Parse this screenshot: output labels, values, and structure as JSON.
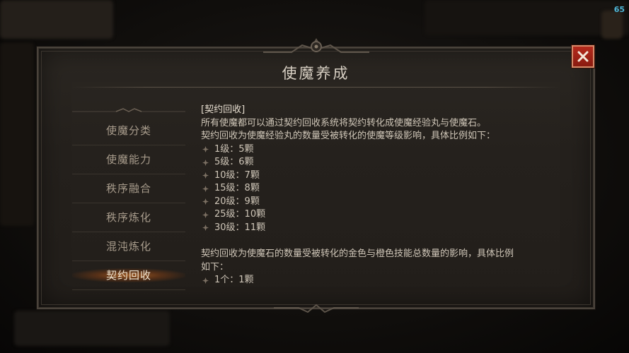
{
  "fps": "65",
  "dialog": {
    "title": "使魔养成",
    "close_icon": "close-x-icon"
  },
  "sidebar": {
    "items": [
      {
        "label": "使魔分类",
        "active": false
      },
      {
        "label": "使魔能力",
        "active": false
      },
      {
        "label": "秩序融合",
        "active": false
      },
      {
        "label": "秩序炼化",
        "active": false
      },
      {
        "label": "混沌炼化",
        "active": false
      },
      {
        "label": "契约回收",
        "active": true
      }
    ]
  },
  "content": {
    "heading": "[契约回收]",
    "line1": "所有使魔都可以通过契约回收系统将契约转化成使魔经验丸与使魔石。",
    "line2": "契约回收为使魔经验丸的数量受被转化的使魔等级影响，具体比例如下：",
    "level_rates": [
      "1级：5颗",
      "5级：6颗",
      "10级：7颗",
      "15级：8颗",
      "20级：9颗",
      "25级：10颗",
      "30级：11颗"
    ],
    "line3a": "契约回收为使魔石的数量受被转化的金色与橙色技能总数量的影响，具体比例",
    "line3b": "如下：",
    "skill_rates": [
      "1个：1颗"
    ]
  },
  "colors": {
    "accent_orange": "#c86e28",
    "close_red": "#a3231a",
    "text_main": "#cfc6b8"
  }
}
